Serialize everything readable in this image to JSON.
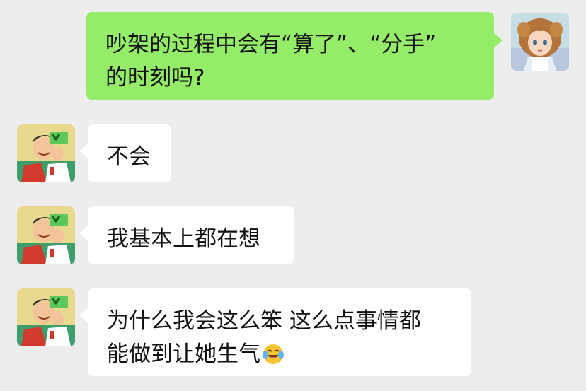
{
  "colors": {
    "chat_background": "#ededed",
    "outgoing_bubble": "#95ec69",
    "incoming_bubble": "#ffffff",
    "text": "#111111"
  },
  "messages": [
    {
      "sender": "me",
      "avatar_icon": "cartoon-girl-avatar",
      "lines": [
        "吵架的过程中会有“算了”、“分手”",
        "的时刻吗?"
      ]
    },
    {
      "sender": "other",
      "avatar_icon": "cartoon-boy-avatar",
      "lines": [
        "不会"
      ]
    },
    {
      "sender": "other",
      "avatar_icon": "cartoon-boy-avatar",
      "lines": [
        "我基本上都在想"
      ]
    },
    {
      "sender": "other",
      "avatar_icon": "cartoon-boy-avatar",
      "lines": [
        "为什么我会这么笨 这么点事情都",
        "能做到让她生气"
      ],
      "trailing_emoji_icon": "laughing-crying-face-icon"
    }
  ]
}
